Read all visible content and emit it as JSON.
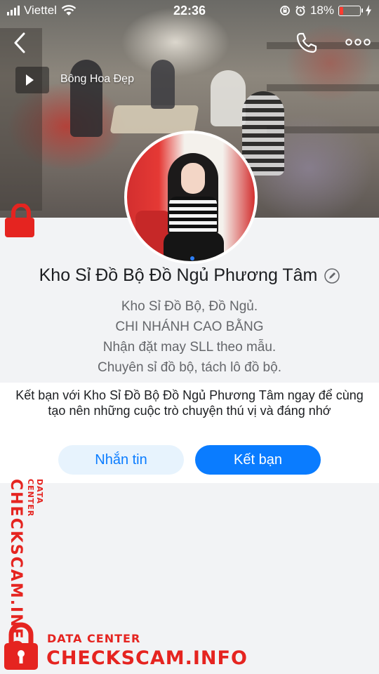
{
  "status_bar": {
    "carrier": "Viettel",
    "time": "22:36",
    "battery": "18%",
    "battery_level": 0.18,
    "battery_color": "#ff3b30"
  },
  "cover": {
    "music_title": "Bông Hoa Đẹp"
  },
  "profile": {
    "name": "Kho Sỉ Đồ Bộ Đồ Ngủ Phương Tâm",
    "bio": [
      "Kho Sỉ Đồ Bộ, Đồ Ngủ.",
      "CHI NHÁNH CAO BẰNG",
      "Nhận đặt may SLL theo mẫu.",
      "Chuyên sỉ đồ bộ, tách lô đồ bộ."
    ]
  },
  "invite": {
    "text": "Kết bạn với Kho Sỉ Đồ Bộ Đồ Ngủ Phương Tâm ngay để cùng tạo nên những cuộc trò chuyện thú vị và đáng nhớ",
    "message_button": "Nhắn tin",
    "add_friend_button": "Kết bạn"
  },
  "watermark": {
    "small": "DATA CENTER",
    "big": "CHECKSCAM.INFO",
    "color": "#e52420"
  },
  "colors": {
    "accent": "#0a7cff",
    "accent_light": "#e7f3fd"
  }
}
